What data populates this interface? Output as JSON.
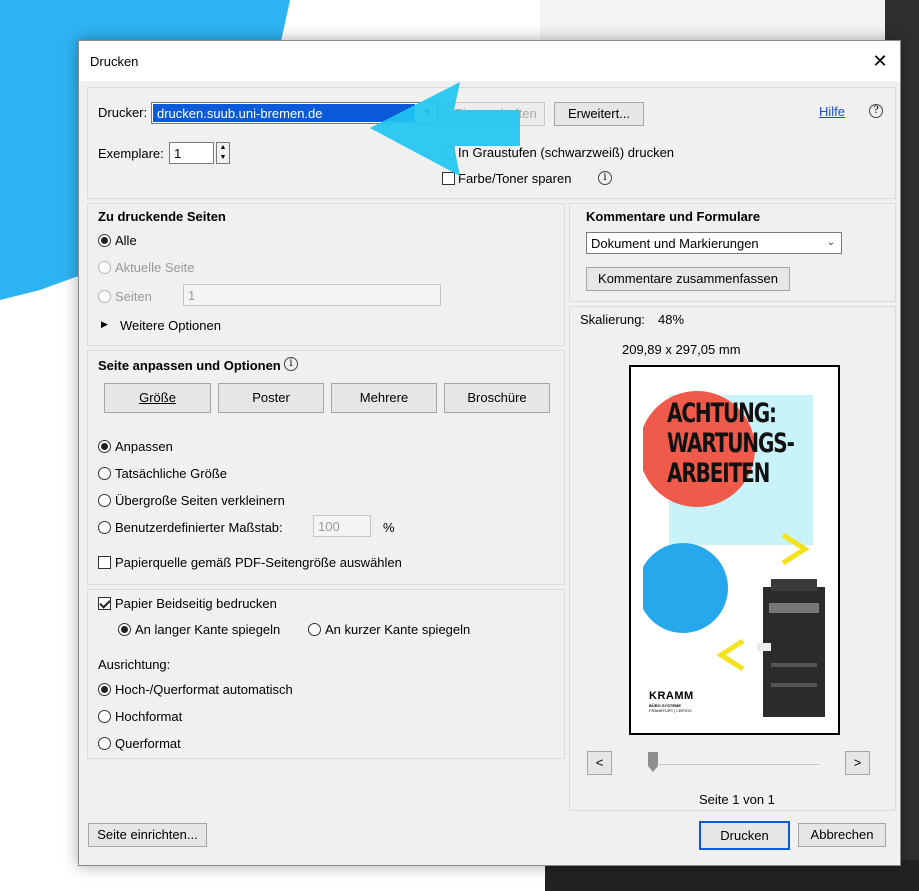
{
  "window": {
    "title": "Drucken",
    "close_glyph": "✕"
  },
  "printer": {
    "label": "Drucker:",
    "value": "drucken.suub.uni-bremen.de",
    "properties_btn": "Eigenschaften",
    "advanced_btn": "Erweitert...",
    "help": "Hilfe",
    "help_icon": "?"
  },
  "copies": {
    "label": "Exemplare:",
    "value": "1"
  },
  "grayscale": {
    "label": "In Graustufen (schwarzweiß) drucken",
    "checked": false
  },
  "save_toner": {
    "label": "Farbe/Toner sparen",
    "checked": false
  },
  "pages_to_print": {
    "heading": "Zu druckende Seiten",
    "all": "Alle",
    "current": "Aktuelle Seite",
    "pages": "Seiten",
    "pages_value": "1",
    "more_options": "Weitere Optionen",
    "more_options_glyph": "▶"
  },
  "fit_options": {
    "heading": "Seite anpassen und Optionen",
    "tabs": [
      "Größe",
      "Poster",
      "Mehrere",
      "Broschüre"
    ],
    "fit": "Anpassen",
    "actual_size": "Tatsächliche Größe",
    "shrink_oversized": "Übergroße Seiten verkleinern",
    "custom_scale": "Benutzerdefinierter Maßstab:",
    "custom_scale_value": "100",
    "percent": "%",
    "paper_source": "Papierquelle gemäß PDF-Seitengröße auswählen"
  },
  "duplex": {
    "label": "Papier Beidseitig bedrucken",
    "checked": true,
    "long_edge": "An langer Kante spiegeln",
    "short_edge": "An kurzer Kante spiegeln"
  },
  "orientation": {
    "heading": "Ausrichtung:",
    "auto": "Hoch-/Querformat automatisch",
    "portrait": "Hochformat",
    "landscape": "Querformat"
  },
  "comments": {
    "heading": "Kommentare und Formulare",
    "value": "Dokument und Markierungen",
    "summarize_btn": "Kommentare zusammenfassen"
  },
  "preview": {
    "scaling_label": "Skalierung:",
    "scaling_value": "48%",
    "dimensions": "209,89 x 297,05 mm",
    "poster_lines": [
      "ACHTUNG:",
      "WARTUNGS-",
      "ARBEITEN"
    ],
    "poster_logo": "KRAMM",
    "poster_logo_sub": "BÜRO SYSTEME",
    "poster_logo_sub2": "FRANKFURT | LEIPZIG",
    "prev_btn": "<",
    "next_btn": ">",
    "page_indicator": "Seite 1 von 1",
    "page_fraction": 0.0
  },
  "footer": {
    "page_setup": "Seite einrichten...",
    "print": "Drucken",
    "cancel": "Abbrechen"
  },
  "colors": {
    "accent": "#0b5ad9",
    "overlay_cyan": "#1fc6f1",
    "poster_red": "#f05a4a",
    "poster_cyan": "#c9f3fb",
    "poster_blue": "#27a8ec",
    "poster_yellow": "#f4e21c"
  }
}
